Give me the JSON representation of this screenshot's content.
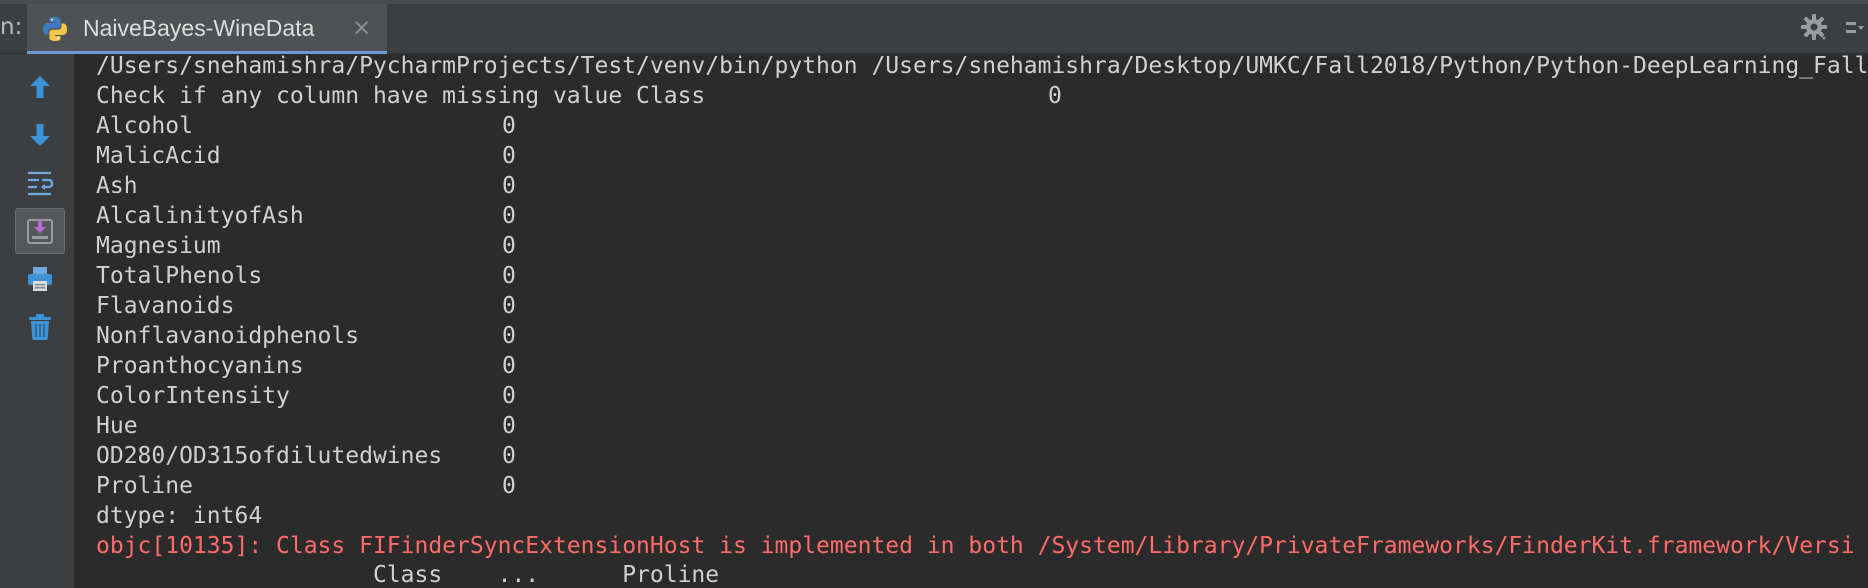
{
  "tool_window": {
    "prefix_label": "n:"
  },
  "run_tab": {
    "label": "NaiveBayes-WineData",
    "close_glyph": "×",
    "icon": "python-icon"
  },
  "toolbar_icons": [
    "up-arrow-icon",
    "down-arrow-icon",
    "soft-wrap-icon",
    "scroll-to-end-icon",
    "print-icon",
    "trash-icon"
  ],
  "header_icons": [
    "gear-icon",
    "hide-icon"
  ],
  "console": {
    "command": "/Users/snehamishra/PycharmProjects/Test/venv/bin/python /Users/snehamishra/Desktop/UMKC/Fall2018/Python/Python-DeepLearning_Fall",
    "missing_header_label": "Check if any column have missing value Class",
    "missing_header_value": "0",
    "missing_rows": [
      {
        "name": "Alcohol",
        "value": "0"
      },
      {
        "name": "MalicAcid",
        "value": "0"
      },
      {
        "name": "Ash",
        "value": "0"
      },
      {
        "name": "AlcalinityofAsh",
        "value": "0"
      },
      {
        "name": "Magnesium",
        "value": "0"
      },
      {
        "name": "TotalPhenols",
        "value": "0"
      },
      {
        "name": "Flavanoids",
        "value": "0"
      },
      {
        "name": "Nonflavanoidphenols",
        "value": "0"
      },
      {
        "name": "Proanthocyanins",
        "value": "0"
      },
      {
        "name": "ColorIntensity",
        "value": "0"
      },
      {
        "name": "Hue",
        "value": "0"
      },
      {
        "name": "OD280/OD315ofdilutedwines",
        "value": "0"
      },
      {
        "name": "Proline",
        "value": "0"
      }
    ],
    "dtype_line": "dtype: int64",
    "error_line": "objc[10135]: Class FIFinderSyncExtensionHost is implemented in both /System/Library/PrivateFrameworks/FinderKit.framework/Versi",
    "table_header_line": "                    Class    ...      Proline"
  },
  "colors": {
    "background": "#2b2b2b",
    "panel": "#3c3f41",
    "text": "#d0d0d0",
    "error": "#ff6b68",
    "accent": "#6b9bd2"
  }
}
